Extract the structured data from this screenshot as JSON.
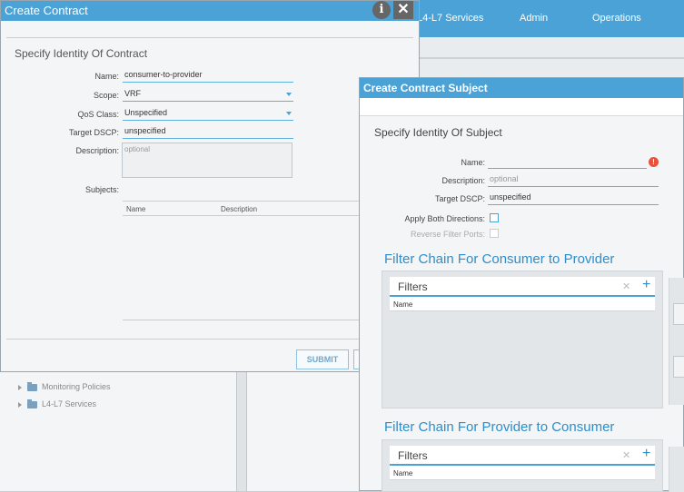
{
  "top_nav": [
    "L4-L7 Services",
    "Admin",
    "Operations"
  ],
  "contract_dialog": {
    "title": "Create Contract",
    "section_title": "Specify Identity Of Contract",
    "labels": {
      "name": "Name:",
      "scope": "Scope:",
      "qos": "QoS Class:",
      "dscp": "Target DSCP:",
      "description": "Description:",
      "subjects": "Subjects:"
    },
    "values": {
      "name": "consumer-to-provider",
      "scope": "VRF",
      "qos": "Unspecified",
      "dscp": "unspecified",
      "description_placeholder": "optional"
    },
    "subjects_columns": [
      "Name",
      "Description"
    ],
    "submit_label": "SUBMIT"
  },
  "tree": {
    "items": [
      "Monitoring Policies",
      "L4-L7 Services"
    ]
  },
  "subject_dialog": {
    "title": "Create Contract Subject",
    "section_title": "Specify Identity Of Subject",
    "labels": {
      "name": "Name:",
      "description": "Description:",
      "dscp": "Target DSCP:",
      "apply_both": "Apply Both Directions:",
      "reverse": "Reverse Filter Ports:"
    },
    "values": {
      "name": "",
      "description_placeholder": "optional",
      "dscp": "unspecified"
    },
    "chains": [
      {
        "title": "Filter Chain For Consumer to Provider",
        "filters_label": "Filters",
        "column": "Name"
      },
      {
        "title": "Filter Chain For Provider to Consumer",
        "filters_label": "Filters",
        "column": "Name"
      }
    ]
  },
  "colors": {
    "accent": "#4aa2d6",
    "link": "#2f8dc9",
    "error": "#e8513c"
  },
  "icons": [
    "info-icon",
    "close-icon",
    "error-icon",
    "add-icon",
    "remove-icon",
    "folder-icon",
    "expand-arrow-icon",
    "dropdown-caret-icon"
  ]
}
